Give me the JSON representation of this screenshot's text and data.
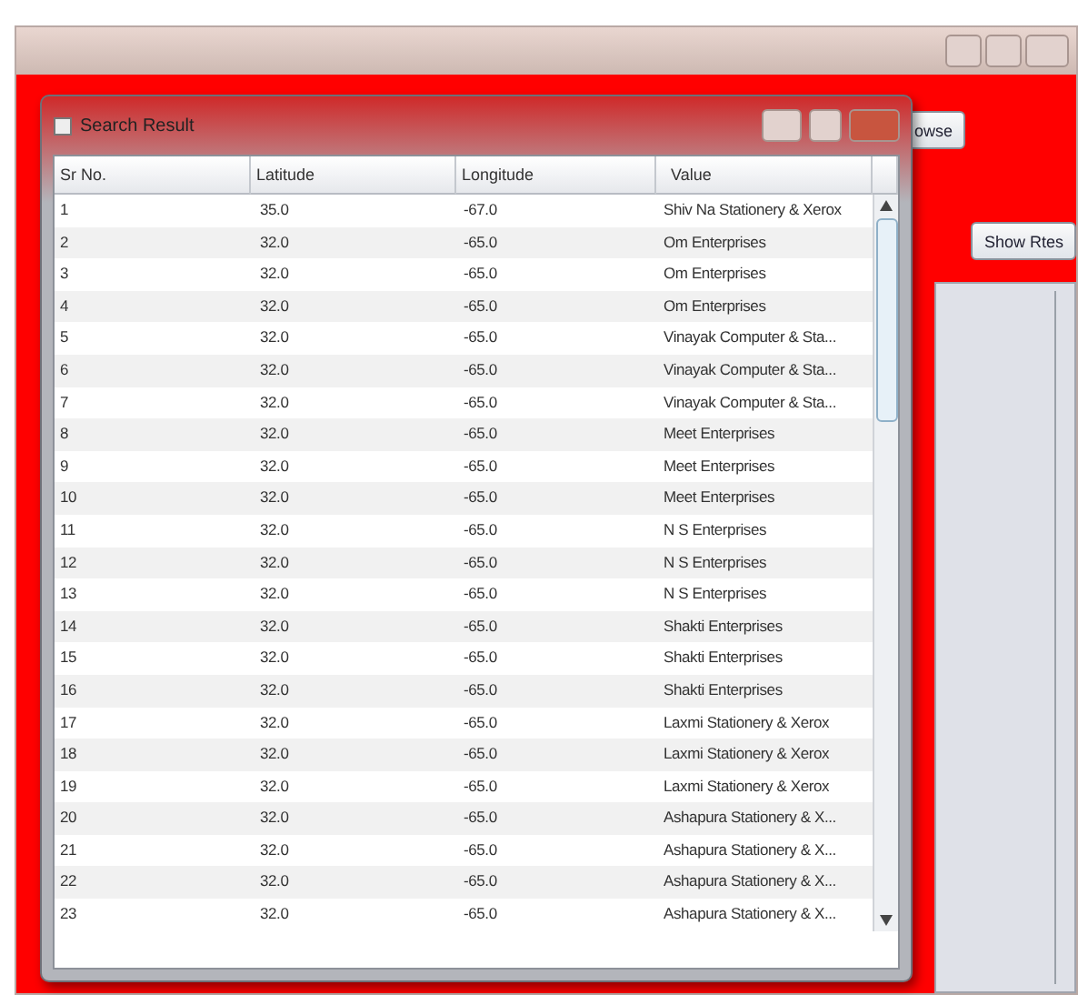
{
  "main_window": {
    "buttons": [
      {
        "label": "owse"
      },
      {
        "label": "Show Rtes"
      }
    ]
  },
  "dialog": {
    "title": "Search Result",
    "table": {
      "columns": [
        "Sr No.",
        "Latitude",
        "Longitude",
        "Value"
      ],
      "rows": [
        [
          "1",
          "35.0",
          "-67.0",
          "Shiv Na Stationery & Xerox"
        ],
        [
          "2",
          "32.0",
          "-65.0",
          "Om Enterprises"
        ],
        [
          "3",
          "32.0",
          "-65.0",
          "Om Enterprises"
        ],
        [
          "4",
          "32.0",
          "-65.0",
          "Om Enterprises"
        ],
        [
          "5",
          "32.0",
          "-65.0",
          "Vinayak Computer & Sta..."
        ],
        [
          "6",
          "32.0",
          "-65.0",
          "Vinayak Computer & Sta..."
        ],
        [
          "7",
          "32.0",
          "-65.0",
          "Vinayak Computer & Sta..."
        ],
        [
          "8",
          "32.0",
          "-65.0",
          "Meet Enterprises"
        ],
        [
          "9",
          "32.0",
          "-65.0",
          "Meet Enterprises"
        ],
        [
          "10",
          "32.0",
          "-65.0",
          "Meet Enterprises"
        ],
        [
          "11",
          "32.0",
          "-65.0",
          "N S Enterprises"
        ],
        [
          "12",
          "32.0",
          "-65.0",
          "N S Enterprises"
        ],
        [
          "13",
          "32.0",
          "-65.0",
          "N S Enterprises"
        ],
        [
          "14",
          "32.0",
          "-65.0",
          "Shakti Enterprises"
        ],
        [
          "15",
          "32.0",
          "-65.0",
          "Shakti Enterprises"
        ],
        [
          "16",
          "32.0",
          "-65.0",
          "Shakti Enterprises"
        ],
        [
          "17",
          "32.0",
          "-65.0",
          "Laxmi Stationery & Xerox"
        ],
        [
          "18",
          "32.0",
          "-65.0",
          "Laxmi Stationery & Xerox"
        ],
        [
          "19",
          "32.0",
          "-65.0",
          "Laxmi Stationery & Xerox"
        ],
        [
          "20",
          "32.0",
          "-65.0",
          "Ashapura Stationery & X..."
        ],
        [
          "21",
          "32.0",
          "-65.0",
          "Ashapura Stationery & X..."
        ],
        [
          "22",
          "32.0",
          "-65.0",
          "Ashapura Stationery & X..."
        ],
        [
          "23",
          "32.0",
          "-65.0",
          "Ashapura Stationery & X..."
        ]
      ]
    }
  }
}
